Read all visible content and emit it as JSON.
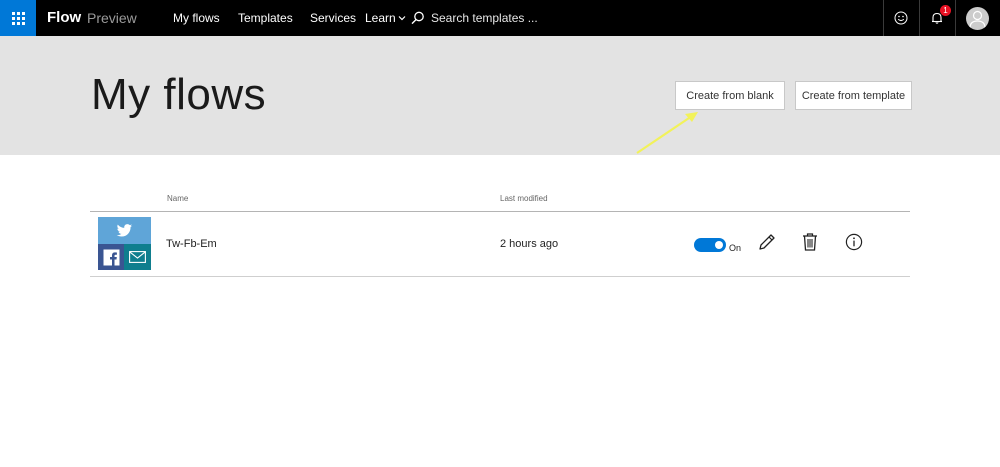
{
  "app": {
    "brand": "Flow",
    "brand_sub": "Preview"
  },
  "nav": {
    "items": [
      {
        "label": "My flows"
      },
      {
        "label": "Templates"
      },
      {
        "label": "Services"
      },
      {
        "label": "Learn"
      }
    ],
    "search_placeholder": "Search templates ...",
    "notification_count": "1"
  },
  "header": {
    "title": "My flows",
    "create_blank_label": "Create from blank",
    "create_template_label": "Create from template"
  },
  "table": {
    "columns": [
      "Name",
      "Last modified"
    ],
    "rows": [
      {
        "name": "Tw-Fb-Em",
        "last_modified": "2 hours ago",
        "status_label": "On",
        "enabled": true,
        "service_icons": [
          "twitter-icon",
          "facebook-icon",
          "mail-icon"
        ]
      }
    ]
  },
  "colors": {
    "topbar": "#000000",
    "waffle": "#0078d7",
    "header_band": "#e3e3e3",
    "toggle_on": "#0078d7",
    "badge": "#e81123",
    "twitter": "#5fa5d8",
    "facebook": "#3a5592",
    "mail": "#0f7e8e",
    "annotation_arrow": "#f2f25a"
  }
}
